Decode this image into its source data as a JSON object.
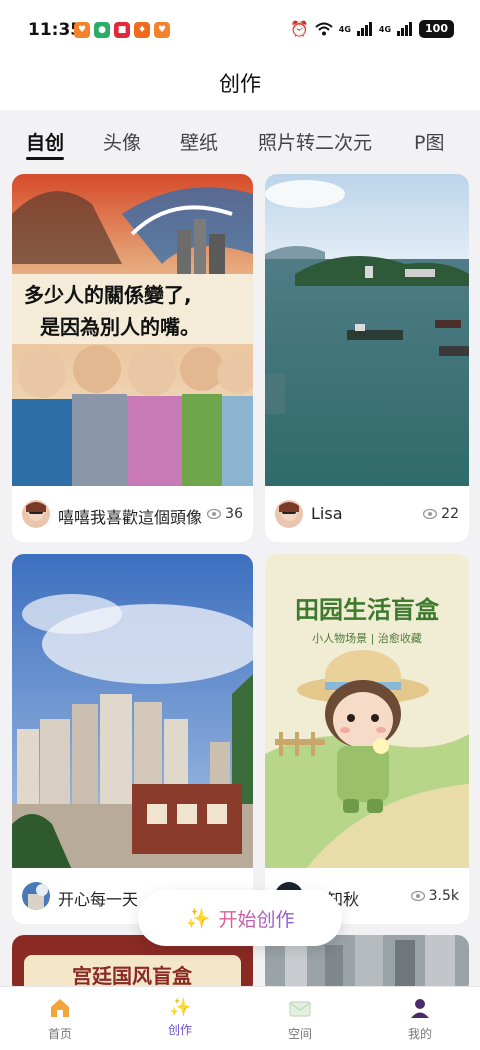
{
  "status_bar": {
    "time": "11:35",
    "network_1": "4G",
    "network_2": "4G",
    "battery": "100",
    "app_icons": [
      {
        "name": "taobao-icon",
        "color": "#f5822a"
      },
      {
        "name": "wechat-icon",
        "color": "#2aae67"
      },
      {
        "name": "xiaohongshu-icon",
        "color": "#e02a3a"
      },
      {
        "name": "taobao-icon-2",
        "color": "#f26a1b"
      },
      {
        "name": "taobao-icon-3",
        "color": "#f5822a"
      }
    ]
  },
  "header": {
    "title": "创作"
  },
  "tabs": [
    {
      "label": "自创",
      "active": true
    },
    {
      "label": "头像"
    },
    {
      "label": "壁纸"
    },
    {
      "label": "照片转二次元"
    },
    {
      "label": "P图"
    }
  ],
  "cards": [
    {
      "author": "嘻嘻我喜歡這個頭像",
      "views": "36",
      "image_caption_line1": "多少人的關係變了,",
      "image_caption_line2": "是因為別人的嘴。"
    },
    {
      "author": "Lisa",
      "views": "22"
    },
    {
      "author": "开心每一天"
    },
    {
      "author": "叶知秋",
      "views": "3.5k",
      "image_title": "田园生活盲盒",
      "image_subtitle": "小人物场景 | 治愈收藏"
    },
    {
      "image_title": "宫廷国风盲盒"
    }
  ],
  "fab": {
    "label": "开始创作",
    "icon": "sparkle-icon"
  },
  "bottom_nav": [
    {
      "label": "首页",
      "icon": "home-icon"
    },
    {
      "label": "创作",
      "icon": "sparkle-icon",
      "active": true
    },
    {
      "label": "空间",
      "icon": "mail-icon"
    },
    {
      "label": "我的",
      "icon": "user-icon"
    }
  ],
  "colors": {
    "accent": "#6c4fcf",
    "fab_gradient_start": "#e65c8f",
    "fab_gradient_end": "#8a5bd6"
  }
}
